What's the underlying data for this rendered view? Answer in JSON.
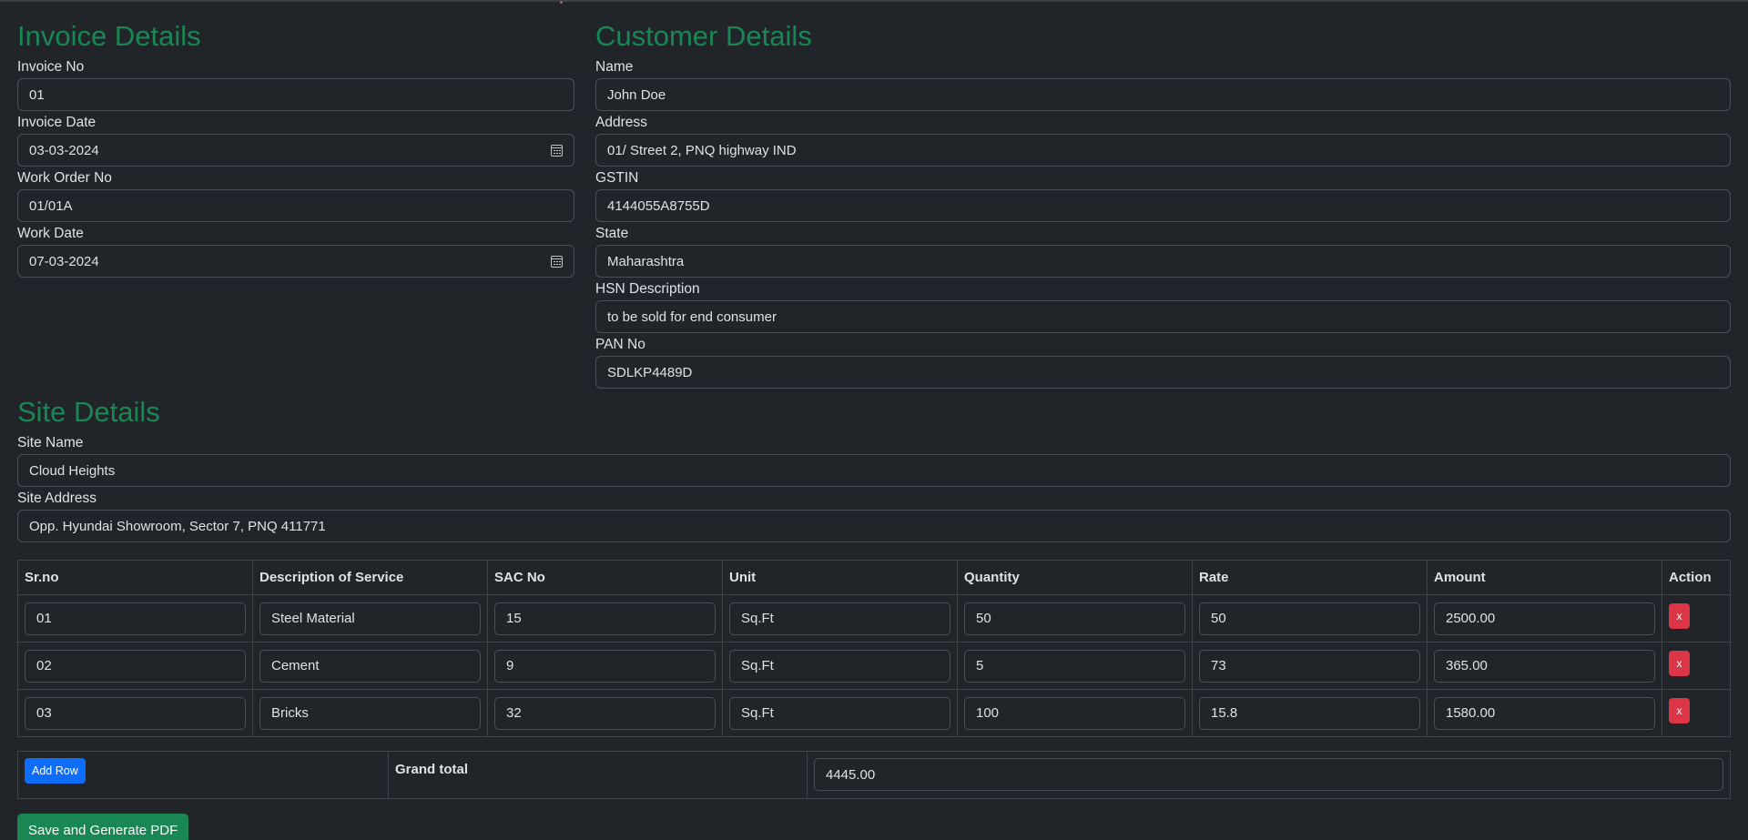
{
  "invoice": {
    "title": "Invoice Details",
    "invoice_no_label": "Invoice No",
    "invoice_no": "01",
    "invoice_date_label": "Invoice Date",
    "invoice_date": "03-03-2024",
    "work_order_label": "Work Order No",
    "work_order": "01/01A",
    "work_date_label": "Work Date",
    "work_date": "07-03-2024"
  },
  "customer": {
    "title": "Customer Details",
    "name_label": "Name",
    "name": "John Doe",
    "address_label": "Address",
    "address": "01/ Street 2, PNQ highway IND",
    "gstin_label": "GSTIN",
    "gstin": "4144055A8755D",
    "state_label": "State",
    "state": "Maharashtra",
    "hsn_label": "HSN Description",
    "hsn": "to be sold for end consumer",
    "pan_label": "PAN No",
    "pan": "SDLKP4489D"
  },
  "site": {
    "title": "Site Details",
    "name_label": "Site Name",
    "name": "Cloud Heights",
    "address_label": "Site Address",
    "address": "Opp. Hyundai Showroom, Sector 7, PNQ 411771"
  },
  "table": {
    "headers": [
      "Sr.no",
      "Description of Service",
      "SAC No",
      "Unit",
      "Quantity",
      "Rate",
      "Amount",
      "Action"
    ],
    "rows": [
      {
        "sr": "01",
        "desc": "Steel Material",
        "sac": "15",
        "unit": "Sq.Ft",
        "qty": "50",
        "rate": "50",
        "amount": "2500.00"
      },
      {
        "sr": "02",
        "desc": "Cement",
        "sac": "9",
        "unit": "Sq.Ft",
        "qty": "5",
        "rate": "73",
        "amount": "365.00"
      },
      {
        "sr": "03",
        "desc": "Bricks",
        "sac": "32",
        "unit": "Sq.Ft",
        "qty": "100",
        "rate": "15.8",
        "amount": "1580.00"
      }
    ],
    "delete_label": "x"
  },
  "totals": {
    "add_row_label": "Add Row",
    "grand_total_label": "Grand total",
    "grand_total": "4445.00"
  },
  "save_label": "Save and Generate PDF",
  "icons": {
    "date_picker": "calendar-icon"
  },
  "colors": {
    "background": "#212529",
    "heading": "#198754",
    "primary": "#0d6efd",
    "danger": "#dc3545",
    "success": "#198754"
  }
}
